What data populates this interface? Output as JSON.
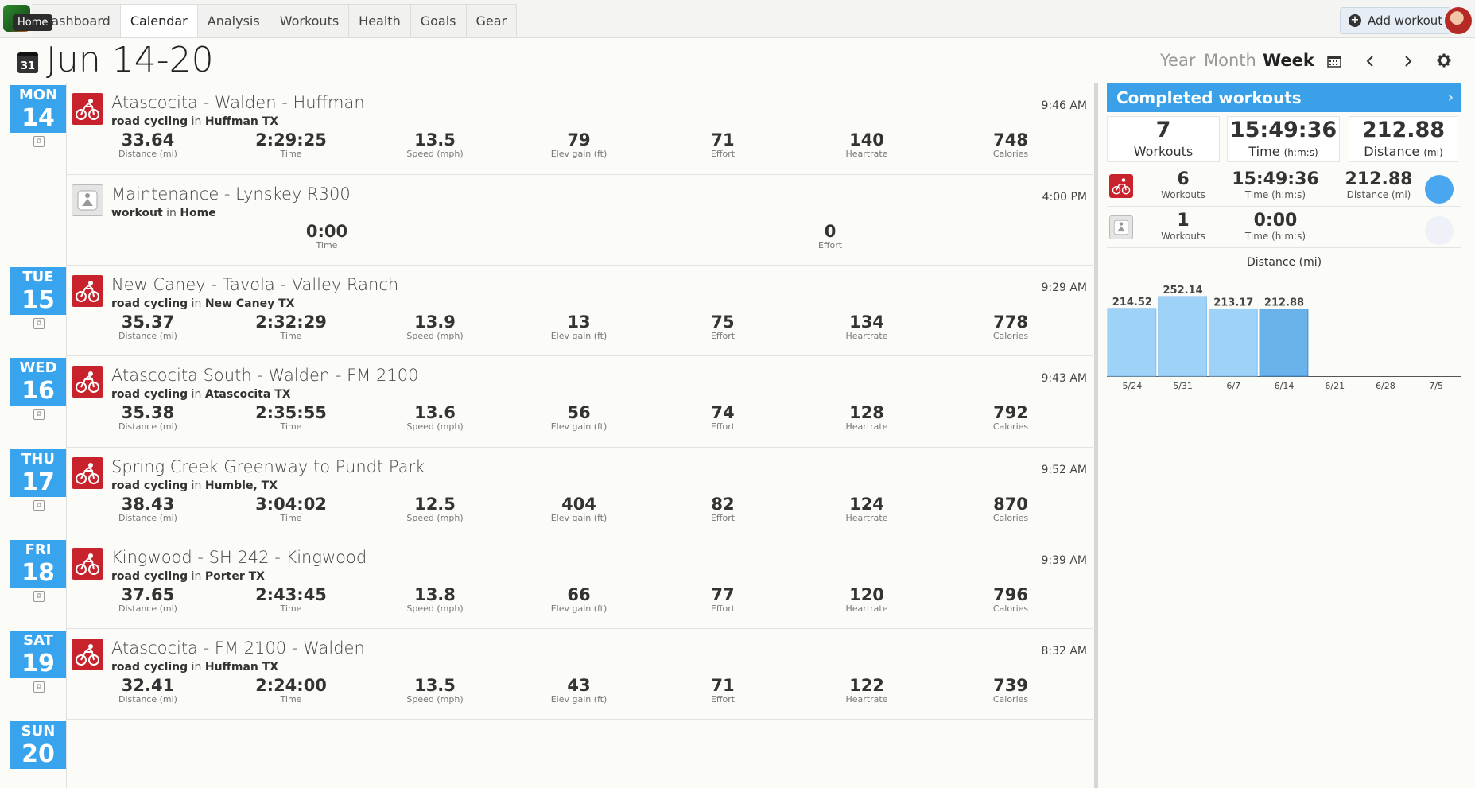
{
  "nav": {
    "home_tooltip": "Home",
    "tabs": [
      "Dashboard",
      "Calendar",
      "Analysis",
      "Workouts",
      "Health",
      "Goals",
      "Gear"
    ],
    "active_tab": "Calendar",
    "add_workout": "Add workout"
  },
  "header": {
    "calendar_icon_day": "31",
    "title": "Jun 14-20",
    "views": [
      "Year",
      "Month",
      "Week"
    ],
    "active_view": "Week"
  },
  "days": [
    {
      "dow": "MON",
      "date": "14"
    },
    {
      "dow": "TUE",
      "date": "15"
    },
    {
      "dow": "WED",
      "date": "16"
    },
    {
      "dow": "THU",
      "date": "17"
    },
    {
      "dow": "FRI",
      "date": "18"
    },
    {
      "dow": "SAT",
      "date": "19"
    },
    {
      "dow": "SUN",
      "date": "20"
    }
  ],
  "stat_labels": {
    "distance": "Distance (mi)",
    "time": "Time",
    "speed": "Speed (mph)",
    "elev": "Elev gain (ft)",
    "effort": "Effort",
    "heartrate": "Heartrate",
    "calories": "Calories"
  },
  "workouts": [
    {
      "title": "Atascocita - Walden - Huffman",
      "type": "road cycling",
      "in": "in",
      "location": "Huffman TX",
      "time_of_day": "9:46 AM",
      "distance": "33.64",
      "duration": "2:29:25",
      "speed": "13.5",
      "elev": "79",
      "effort": "71",
      "heartrate": "140",
      "calories": "748"
    },
    {
      "title": "Maintenance - Lynskey R300",
      "type": "workout",
      "in": "in",
      "location": "Home",
      "time_of_day": "4:00 PM",
      "duration": "0:00",
      "effort": "0"
    },
    {
      "title": "New Caney - Tavola - Valley Ranch",
      "type": "road cycling",
      "in": "in",
      "location": "New Caney TX",
      "time_of_day": "9:29 AM",
      "distance": "35.37",
      "duration": "2:32:29",
      "speed": "13.9",
      "elev": "13",
      "effort": "75",
      "heartrate": "134",
      "calories": "778"
    },
    {
      "title": "Atascocita South - Walden - FM 2100",
      "type": "road cycling",
      "in": "in",
      "location": "Atascocita TX",
      "time_of_day": "9:43 AM",
      "distance": "35.38",
      "duration": "2:35:55",
      "speed": "13.6",
      "elev": "56",
      "effort": "74",
      "heartrate": "128",
      "calories": "792"
    },
    {
      "title": "Spring Creek Greenway to Pundt Park",
      "type": "road cycling",
      "in": "in",
      "location": "Humble, TX",
      "time_of_day": "9:52 AM",
      "distance": "38.43",
      "duration": "3:04:02",
      "speed": "12.5",
      "elev": "404",
      "effort": "82",
      "heartrate": "124",
      "calories": "870"
    },
    {
      "title": "Kingwood - SH 242 - Kingwood",
      "type": "road cycling",
      "in": "in",
      "location": "Porter TX",
      "time_of_day": "9:39 AM",
      "distance": "37.65",
      "duration": "2:43:45",
      "speed": "13.8",
      "elev": "66",
      "effort": "77",
      "heartrate": "120",
      "calories": "796"
    },
    {
      "title": "Atascocita - FM 2100 - Walden",
      "type": "road cycling",
      "in": "in",
      "location": "Huffman TX",
      "time_of_day": "8:32 AM",
      "distance": "32.41",
      "duration": "2:24:00",
      "speed": "13.5",
      "elev": "43",
      "effort": "71",
      "heartrate": "122",
      "calories": "739"
    }
  ],
  "summary": {
    "title": "Completed workouts",
    "totals": {
      "workouts": "7",
      "workouts_label": "Workouts",
      "time": "15:49:36",
      "time_label": "Time",
      "time_unit": "(h:m:s)",
      "distance": "212.88",
      "distance_label": "Distance",
      "distance_unit": "(mi)"
    },
    "rows": [
      {
        "workouts": "6",
        "workouts_label": "Workouts",
        "time": "15:49:36",
        "time_label": "Time (h:m:s)",
        "distance": "212.88",
        "distance_label": "Distance (mi)",
        "dot_color": "#4aa6ee"
      },
      {
        "workouts": "1",
        "workouts_label": "Workouts",
        "time": "0:00",
        "time_label": "Time (h:m:s)",
        "dot_color": "#eef1f8"
      }
    ]
  },
  "colors": {
    "accent": "#39a4ee",
    "cycling_icon": "#c8232c",
    "bar": "#9fd2f7",
    "bar_selected": "#6ab2ea"
  },
  "chart_data": {
    "type": "bar",
    "title": "Distance (mi)",
    "categories": [
      "5/24",
      "5/31",
      "6/7",
      "6/14",
      "6/21",
      "6/28",
      "7/5"
    ],
    "values": [
      214.52,
      252.14,
      213.17,
      212.88,
      null,
      null,
      null
    ],
    "value_labels": [
      "214.52",
      "252.14",
      "213.17",
      "212.88",
      "",
      "",
      ""
    ],
    "selected": "6/14",
    "ylim": [
      0,
      252.14
    ]
  }
}
